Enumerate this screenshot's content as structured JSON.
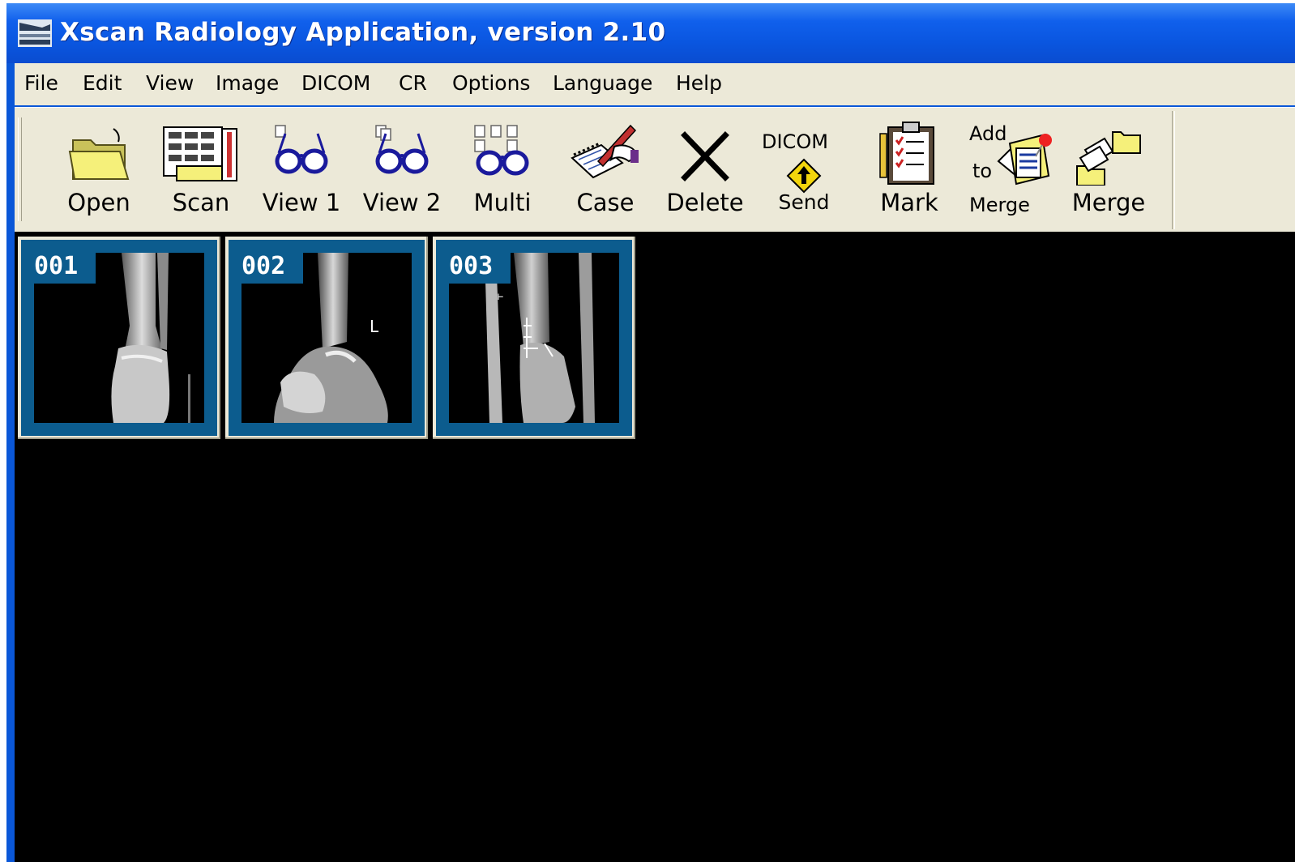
{
  "window": {
    "title": "Xscan Radiology Application, version 2.10"
  },
  "menu": {
    "items": [
      "File",
      "Edit",
      "View",
      "Image",
      "DICOM",
      "CR",
      "Options",
      "Language",
      "Help"
    ]
  },
  "toolbar": {
    "open": {
      "label": "Open",
      "icon": "folder-icon"
    },
    "scan": {
      "label": "Scan",
      "icon": "scanner-icon"
    },
    "view1": {
      "label": "View 1",
      "icon": "glasses-icon"
    },
    "view2": {
      "label": "View 2",
      "icon": "glasses-icon"
    },
    "multi": {
      "label": "Multi",
      "icon": "multi-glasses-icon"
    },
    "case": {
      "label": "Case",
      "icon": "notepad-pen-icon"
    },
    "delete": {
      "label": "Delete",
      "icon": "x-icon"
    },
    "dicom_send": {
      "top": "DICOM",
      "label": "Send",
      "icon": "road-sign-icon"
    },
    "mark": {
      "label": "Mark",
      "icon": "clipboard-checklist-icon"
    },
    "add_to_merge": {
      "line1": "Add",
      "line2": "to",
      "line3": "Merge",
      "icon": "document-pin-icon"
    },
    "merge": {
      "label": "Merge",
      "icon": "merge-documents-icon"
    }
  },
  "thumbnails": [
    {
      "number": "001",
      "view": "AP ankle"
    },
    {
      "number": "002",
      "view": "lateral ankle",
      "marker": "L"
    },
    {
      "number": "003",
      "view": "oblique ankle"
    }
  ],
  "colors": {
    "title_bar": "#0a56e0",
    "chrome": "#ece9d8",
    "thumb_frame": "#0c5c8e",
    "viewer_bg": "#000000"
  }
}
